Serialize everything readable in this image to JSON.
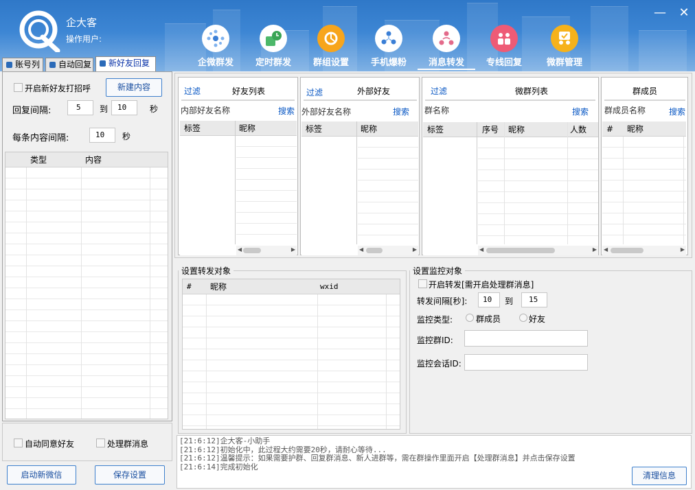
{
  "app": {
    "title": "企大客",
    "operator_label": "操作用户:"
  },
  "window": {
    "minimize": "—",
    "close": "✕"
  },
  "nav": [
    {
      "label": "企微群发",
      "icon": "hub-icon"
    },
    {
      "label": "定时群发",
      "icon": "schedule-icon"
    },
    {
      "label": "群组设置",
      "icon": "group-settings-icon"
    },
    {
      "label": "手机爆粉",
      "icon": "phone-fans-icon"
    },
    {
      "label": "消息转发",
      "icon": "message-forward-icon"
    },
    {
      "label": "专线回复",
      "icon": "dedicated-reply-icon"
    },
    {
      "label": "微群管理",
      "icon": "group-manage-icon"
    }
  ],
  "left_tabs": [
    {
      "label": "账号列"
    },
    {
      "label": "自动回复"
    },
    {
      "label": "新好友回复"
    }
  ],
  "new_friend": {
    "greet_label": "开启新好友打招呼",
    "new_content_button": "新建内容",
    "reply_interval_label": "回复间隔:",
    "reply_from": "5",
    "to_label": "到",
    "reply_to": "10",
    "sec_label": "秒",
    "item_interval_label": "每条内容间隔:",
    "item_interval": "10",
    "item_sec_label": "秒",
    "columns": [
      "类型",
      "内容"
    ]
  },
  "left_bottom": {
    "auto_accept_label": "自动同意好友",
    "process_group_label": "处理群消息",
    "start_wechat_button": "启动新微信",
    "save_settings_button": "保存设置"
  },
  "friends": {
    "filter": "过滤",
    "title": "好友列表",
    "search_label": "内部好友名称",
    "search_button": "搜索",
    "columns": [
      "标签",
      "昵称"
    ]
  },
  "external": {
    "filter": "过滤",
    "title": "外部好友",
    "search_label": "外部好友名称",
    "search_button": "搜索",
    "columns": [
      "标签",
      "昵称"
    ]
  },
  "wgroups": {
    "filter": "过滤",
    "title": "微群列表",
    "search_label": "群名称",
    "search_button": "搜索",
    "columns": [
      "标签",
      "序号",
      "昵称",
      "人数"
    ]
  },
  "members": {
    "title": "群成员",
    "search_label": "群成员名称",
    "search_button": "搜索",
    "columns": [
      "#",
      "昵称"
    ]
  },
  "forward_target": {
    "legend": "设置转发对象",
    "columns": [
      "#",
      "昵称",
      "wxid"
    ]
  },
  "monitor": {
    "legend": "设置监控对象",
    "enable_label": "开启转发[需开启处理群消息]",
    "interval_label": "转发间隔[秒]:",
    "interval_from": "10",
    "to_label": "到",
    "interval_to": "15",
    "type_label": "监控类型:",
    "opt_member": "群成员",
    "opt_friend": "好友",
    "group_id_label": "监控群ID:",
    "session_id_label": "监控会话ID:"
  },
  "log": {
    "lines": [
      "[21:6:12]企大客-小助手",
      "[21:6:12]初始化中，此过程大约需要20秒，请耐心等待...",
      "[21:6:12]温馨提示：如果需要护群、回复群消息、新人进群等，需在群操作里面开启【处理群消息】并点击保存设置",
      "[21:6:14]完成初始化"
    ],
    "clear_button": "清理信息"
  }
}
